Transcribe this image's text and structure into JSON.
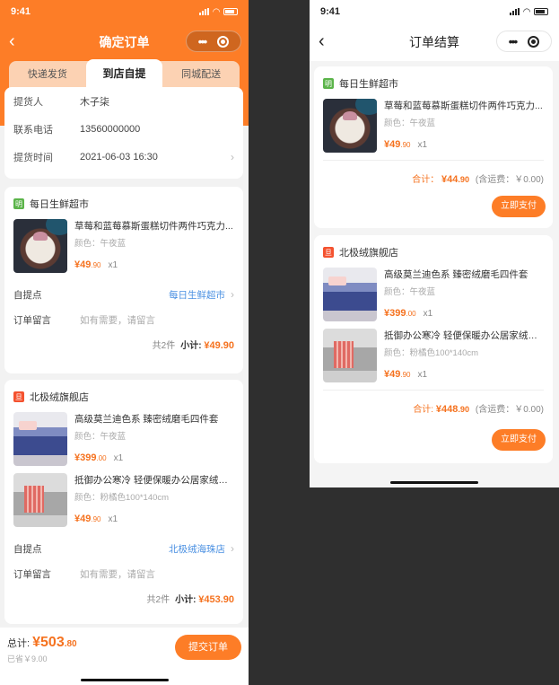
{
  "left": {
    "status": {
      "time": "9:41"
    },
    "nav": {
      "title": "确定订单"
    },
    "tabs": [
      "快递发货",
      "到店自提",
      "同城配送"
    ],
    "pickup": [
      {
        "label": "提货人",
        "value": "木子柒"
      },
      {
        "label": "联系电话",
        "value": "13560000000"
      },
      {
        "label": "提货时间",
        "value": "2021-06-03 16:30"
      }
    ],
    "stores": [
      {
        "name": "每日生鲜超市",
        "icon": "明",
        "items": [
          {
            "name": "草莓和蓝莓慕斯蛋糕切件两件巧克力...",
            "spec": "颜色：午夜蓝",
            "price_int": "¥49",
            "price_dec": ".90",
            "qty": "x1"
          }
        ],
        "pickup_label": "自提点",
        "pickup_value": "每日生鲜超市",
        "note_label": "订单留言",
        "note_placeholder": "如有需要，请留言",
        "count": "共2件",
        "subtotal_label": "小计:",
        "subtotal": "¥49.90"
      },
      {
        "name": "北极绒旗舰店",
        "icon": "旦",
        "items": [
          {
            "name": "高级莫兰迪色系  臻密绒磨毛四件套",
            "spec": "颜色：午夜蓝",
            "price_int": "¥399",
            "price_dec": ".00",
            "qty": "x1"
          },
          {
            "name": "抵御办公寒冷 轻便保暖办公居家绒毯...",
            "spec": "颜色：粉橘色100*140cm",
            "price_int": "¥49",
            "price_dec": ".90",
            "qty": "x1"
          }
        ],
        "pickup_label": "自提点",
        "pickup_value": "北极绒海珠店",
        "note_label": "订单留言",
        "note_placeholder": "如有需要，请留言",
        "count": "共2件",
        "subtotal_label": "小计:",
        "subtotal": "¥453.90"
      }
    ],
    "footer": {
      "total_label": "总计:",
      "total_int": "¥503",
      "total_dec": ".80",
      "saved": "已省￥9.00",
      "submit": "提交订单"
    }
  },
  "right": {
    "status": {
      "time": "9:41"
    },
    "nav": {
      "title": "订单结算"
    },
    "orders": [
      {
        "store": "每日生鲜超市",
        "icon": "明",
        "items": [
          {
            "name": "草莓和蓝莓慕斯蛋糕切件两件巧克力...",
            "spec": "颜色：午夜蓝",
            "price_int": "¥49",
            "price_dec": ".90",
            "qty": "x1"
          }
        ],
        "sum_label": "合计：",
        "sum_int": "¥44",
        "sum_dec": ".90",
        "fee": "(含运费：￥0.00)",
        "pay": "立即支付"
      },
      {
        "store": "北极绒旗舰店",
        "icon": "旦",
        "items": [
          {
            "name": "高级莫兰迪色系  臻密绒磨毛四件套",
            "spec": "颜色：午夜蓝",
            "price_int": "¥399",
            "price_dec": ".00",
            "qty": "x1"
          },
          {
            "name": "抵御办公寒冷 轻便保暖办公居家绒毯...",
            "spec": "颜色：粉橘色100*140cm",
            "price_int": "¥49",
            "price_dec": ".90",
            "qty": "x1"
          }
        ],
        "sum_label": "合计:",
        "sum_int": "¥448",
        "sum_dec": ".90",
        "fee": "(含运费：￥0.00)",
        "pay": "立即支付"
      }
    ]
  }
}
